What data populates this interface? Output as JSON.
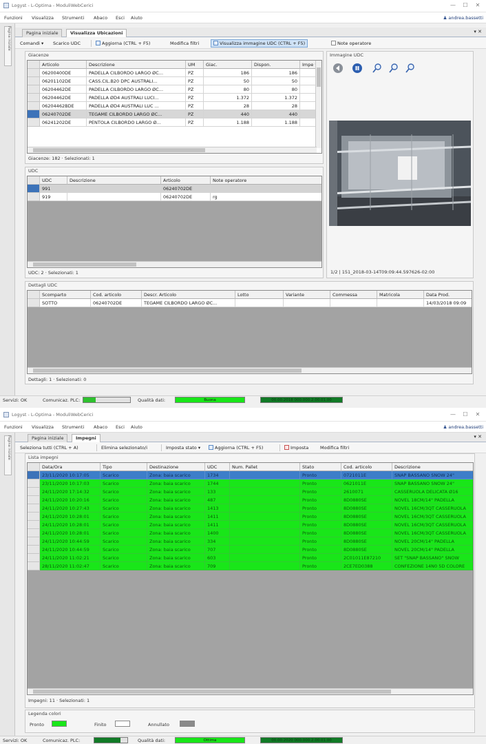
{
  "window1": {
    "title": "Logyst - L-Optima - ModuliWebCerici",
    "controls": [
      "—",
      "☐",
      "✕"
    ],
    "menu": [
      "Funzioni",
      "Visualizza",
      "Strumenti",
      "Abaco",
      "Esci",
      "Aiuto"
    ],
    "user": "andrea.bassetti",
    "side_tab": "Pagina iniziale",
    "tabs": [
      "Pagina iniziale",
      "Visualizza Ubicazioni"
    ],
    "tab_pin": "▾ ✕",
    "toolbar": [
      "Comandi ▾",
      "Scarico UDC",
      "Aggiorna (CTRL + F5)",
      "Modifica filtri",
      "Visualizza immagine UDC (CTRL + F5)",
      "Note operatore"
    ],
    "giacenze": {
      "label": "Giacenze",
      "columns": [
        "Articolo",
        "Descrizione",
        "UM",
        "Giac.",
        "Dispon.",
        "Impe ▾"
      ],
      "rows": [
        [
          "06200400DE",
          "PADELLA CILBORDO LARGO ØC...",
          "PZ",
          "186",
          "186",
          ""
        ],
        [
          "06201102DE",
          "CASS.CIL.B20 DPC AUSTRALI...",
          "PZ",
          "50",
          "50",
          ""
        ],
        [
          "06204462DE",
          "PADELLA CILBORDO LARGO ØC...",
          "PZ",
          "80",
          "80",
          ""
        ],
        [
          "06204462DE",
          "PADELLA ØD4 AUSTRALI LUCI...",
          "PZ",
          "1.372",
          "1.372",
          ""
        ],
        [
          "06204462BDE",
          "PADELLA ØD4 AUSTRALI LUC ...",
          "PZ",
          "28",
          "28",
          ""
        ],
        [
          "06240702DE",
          "TEGAME CILBORDO LARGO ØC...",
          "PZ",
          "440",
          "440",
          ""
        ],
        [
          "06241202DE",
          "PENTOLA CILBORDO LARGO Ø...",
          "PZ",
          "1.188",
          "1.188",
          ""
        ]
      ],
      "status": "Giacenze: 182 · Selezionati: 1"
    },
    "udc": {
      "label": "UDC",
      "columns": [
        "UDC",
        "Descrizione",
        "Articolo",
        "Note operatore"
      ],
      "rows": [
        [
          "991",
          "",
          "06240702DE",
          ""
        ],
        [
          "919",
          "",
          "06240702DE",
          "rg"
        ]
      ],
      "status": "UDC: 2 · Selezionati: 1"
    },
    "immagine": {
      "label": "Immagine UDC",
      "caption": "1/2 | 151_2018-03-14T09:09:44.597626-02:00"
    },
    "dettagli": {
      "label": "Dettagli UDC",
      "columns": [
        "Scomparto",
        "Cod. articolo",
        "Descr. Articolo",
        "Lotto",
        "Variante",
        "Commessa",
        "Matricola",
        "Data Prod."
      ],
      "rows": [
        [
          "SOTTO",
          "06240702DE",
          "TEGAME CILBORDO LARGO ØC...",
          "",
          "",
          "",
          "",
          "14/03/2018 09:09"
        ]
      ],
      "status": "Dettagli: 1 · Selezionati: 0"
    },
    "statusbar": {
      "server": "Servizi: OK",
      "plc": "Comunicaz. PLC:",
      "quality": "Qualità dati:",
      "quality_value": "Buona",
      "info": "00.00.2018 000.000.2.00.01.00"
    }
  },
  "window2": {
    "title": "Logyst - L-Optima - ModuliWebCerici",
    "controls": [
      "—",
      "☐",
      "✕"
    ],
    "menu": [
      "Funzioni",
      "Visualizza",
      "Strumenti",
      "Abaco",
      "Esci",
      "Aiuto"
    ],
    "user": "andrea.bassetti",
    "side_tab": "Pagina iniziale",
    "tabs": [
      "Pagina iniziale",
      "Impegni"
    ],
    "tab_pin": "▾ ✕",
    "toolbar": [
      "Seleziona tutti (CTRL + A)",
      "Elimina selezionato/i",
      "Imposta stato ▾",
      "Aggiorna (CTRL + F5)",
      "Imposta",
      "Modifica filtri"
    ],
    "impegni": {
      "label": "Lista impegni",
      "columns": [
        "Data/Ora",
        "Tipo",
        "Destinazione",
        "UDC",
        "Num. Pallet",
        "Stato",
        "Cod. articolo",
        "Descrizione"
      ],
      "rows": [
        [
          "23/11/2020 10:17:05",
          "Scarico",
          "Zona: baia scarico",
          "1734",
          "",
          "Pronto",
          "0721011E",
          "SNAP BASSANO SNOW 24\""
        ],
        [
          "23/11/2020 10:17:03",
          "Scarico",
          "Zona: baia scarico",
          "1744",
          "",
          "Pronto",
          "0621011E",
          "SNAP BASSANO SNOW 24\""
        ],
        [
          "24/11/2020 17:14:32",
          "Scarico",
          "Zona: baia scarico",
          "133",
          "",
          "Pronto",
          "2610071",
          "CASSERUOLA DELICATA Ø16"
        ],
        [
          "24/11/2020 10:20:16",
          "Scarico",
          "Zona: baia scarico",
          "487",
          "",
          "Pronto",
          "8D0880SE",
          "NOVEL 18CM/14\" PADELLA"
        ],
        [
          "24/11/2020 10:27:43",
          "Scarico",
          "Zona: baia scarico",
          "1413",
          "",
          "Pronto",
          "8D0880SE",
          "NOVEL 16CM/3QT CASSERUOLA"
        ],
        [
          "24/11/2020 10:28:01",
          "Scarico",
          "Zona: baia scarico",
          "1411",
          "",
          "Pronto",
          "8D0880SE",
          "NOVEL 16CM/3QT CASSERUOLA"
        ],
        [
          "24/11/2020 10:28:01",
          "Scarico",
          "Zona: baia scarico",
          "1411",
          "",
          "Pronto",
          "8D0880SE",
          "NOVEL 16CM/3QT CASSERUOLA"
        ],
        [
          "24/11/2020 10:28:01",
          "Scarico",
          "Zona: baia scarico",
          "1400",
          "",
          "Pronto",
          "8D0880SE",
          "NOVEL 16CM/3QT CASSERUOLA"
        ],
        [
          "24/11/2020 10:44:59",
          "Scarico",
          "Zona: baia scarico",
          "334",
          "",
          "Pronto",
          "8D0880SE",
          "NOVEL 20CM/14\" PADELLA"
        ],
        [
          "24/11/2020 10:44:59",
          "Scarico",
          "Zona: baia scarico",
          "707",
          "",
          "Pronto",
          "8D0880SE",
          "NOVEL 20CM/14\" PADELLA"
        ],
        [
          "24/11/2020 11:02:21",
          "Scarico",
          "Zona: baia scarico",
          "603",
          "",
          "Pronto",
          "2C01011E87210",
          "SET \"SNAP BASSANO\" SNOW"
        ],
        [
          "28/11/2020 11:02:47",
          "Scarico",
          "Zona: baia scarico",
          "709",
          "",
          "Pronto",
          "2CE7ED0388",
          "CONFEZIONE 14N0 5D COLORE"
        ]
      ],
      "status": "Impegni: 11 · Selezionati: 1"
    },
    "legend": {
      "label": "Legenda colori",
      "items": [
        {
          "label": "Pronto",
          "color": "#19e619"
        },
        {
          "label": "Finito",
          "color": "#ffffff"
        },
        {
          "label": "Annullato",
          "color": "#8a8a8a"
        }
      ]
    },
    "statusbar": {
      "server": "Servizi: OK",
      "plc": "Comunicaz. PLC:",
      "quality": "Qualità dati:",
      "quality_value": "Ottima",
      "info": "00.00.2020 000.000.2.00.01.00"
    }
  },
  "colors": {
    "green": "#19e619",
    "selected_blue": "#3d7ec9",
    "highlight_blue": "#cfe2f6",
    "grid_gray": "#a3a3a3",
    "dark_green": "#117a26"
  },
  "icons": [
    "app-icon",
    "user-icon",
    "refresh-icon",
    "image-icon",
    "note-icon",
    "settings-icon",
    "back-icon",
    "pause-icon",
    "zoom-in-icon",
    "zoom-out-icon",
    "zoom-fit-icon"
  ]
}
